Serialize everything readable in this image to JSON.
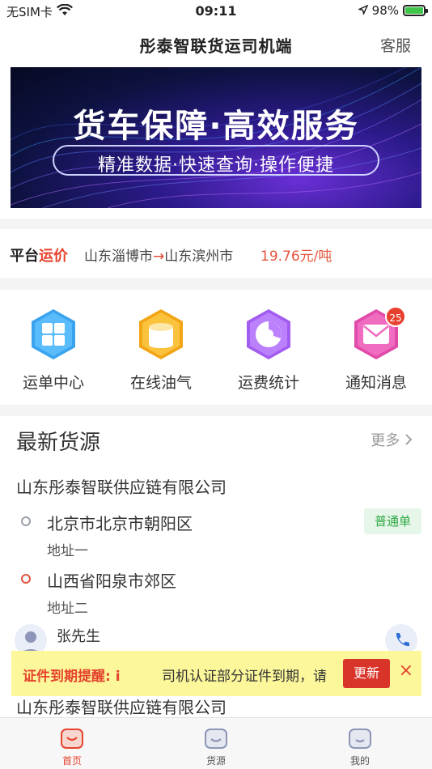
{
  "status_bar": {
    "carrier": "无SIM卡",
    "time": "09:11",
    "battery": "98%",
    "battery_level": 0.98
  },
  "nav": {
    "title": "彤泰智联货运司机端",
    "right_label": "客服"
  },
  "banner": {
    "title": "货车保障·高效服务",
    "subtitle": "精准数据·快速查询·操作便捷"
  },
  "price": {
    "label_a": "平台",
    "label_b": "运价",
    "from": "山东淄博市",
    "arrow": "→",
    "to": "山东滨州市",
    "value": "19.76元/吨"
  },
  "menu": {
    "items": [
      {
        "label": "运单中心",
        "icon": "grid-icon"
      },
      {
        "label": "在线油气",
        "icon": "fuel-tank-icon"
      },
      {
        "label": "运费统计",
        "icon": "pie-chart-icon"
      },
      {
        "label": "通知消息",
        "icon": "mail-icon",
        "badge": "25"
      }
    ]
  },
  "cargo": {
    "title": "最新货源",
    "more": "更多",
    "company": "山东彤泰智联供应链有限公司",
    "from_addr": "北京市北京市朝阳区",
    "from_sub": "地址一",
    "to_addr": "山西省阳泉市郊区",
    "to_sub": "地址二",
    "tag": "普通单",
    "contact": "张先生",
    "next_company": "山东彤泰智联供应链有限公司"
  },
  "warning": {
    "label": "证件到期提醒: i",
    "text": "司机认证部分证件到期，请",
    "button": "更新",
    "close": "×"
  },
  "tabbar": {
    "tabs": [
      {
        "label": "首页",
        "active": true
      },
      {
        "label": "货源",
        "active": false
      },
      {
        "label": "我的",
        "active": false
      }
    ]
  },
  "colors": {
    "accent": "#e5432e",
    "tag_green": "#2fa845",
    "warning_bg": "#fbf79a"
  }
}
